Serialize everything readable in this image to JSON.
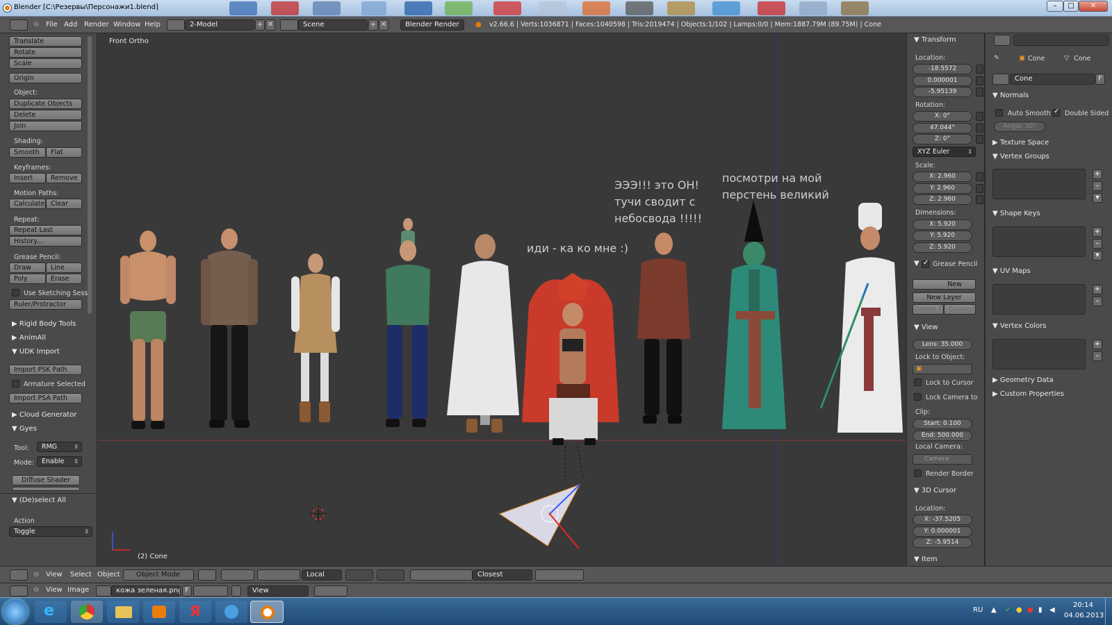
{
  "window": {
    "title": "Blender [C:\\Резервы\\Персонажи1.blend]",
    "minimize": "–",
    "maximize": "□",
    "close": "✕"
  },
  "info_header": {
    "menus": [
      "File",
      "Add",
      "Render",
      "Window",
      "Help"
    ],
    "screen_layout": "2-Model",
    "scene": "Scene",
    "render_engine": "Blender Render",
    "stats": "v2.66.6 | Verts:1036871 | Faces:1040598 | Tris:2019474 | Objects:1/102 | Lamps:0/0 | Mem:1887.79M (89.75M) | Cone"
  },
  "tool_shelf": {
    "transform": [
      "Translate",
      "Rotate",
      "Scale"
    ],
    "origin": "Origin",
    "object_label": "Object:",
    "object_buttons": [
      "Duplicate Objects",
      "Delete",
      "Join"
    ],
    "shading_label": "Shading:",
    "shading": [
      "Smooth",
      "Flat"
    ],
    "keyframes_label": "Keyframes:",
    "keyframes": [
      "Insert",
      "Remove"
    ],
    "motion_label": "Motion Paths:",
    "motion": [
      "Calculate",
      "Clear"
    ],
    "repeat_label": "Repeat:",
    "repeat": [
      "Repeat Last",
      "History..."
    ],
    "grease_label": "Grease Pencil:",
    "grease_row1": [
      "Draw",
      "Line"
    ],
    "grease_row2": [
      "Poly",
      "Erase"
    ],
    "use_sketching": "Use Sketching Sessi",
    "ruler": "Ruler/Protractor",
    "rigid_body": "Rigid Body Tools",
    "animall": "AnimAll",
    "udk_import": "UDK Import",
    "import_psk": "Import PSK Path",
    "armature_selected": "Armature Selected",
    "import_psa": "Import PSA Path",
    "cloud_generator": "Cloud Generator",
    "gyes": "Gyes",
    "tool_label": "Tool:",
    "tool_value": "RMG",
    "mode_label": "Mode:",
    "mode_value": "Enable",
    "diffuse_shader": "Diffuse Shader",
    "deselect_all": "(De)select All",
    "action_label": "Action",
    "action_value": "Toggle"
  },
  "viewport": {
    "view_name": "Front Ortho",
    "active_object": "(2) Cone",
    "speech": {
      "come_here": "иди - ка  ко мне :)",
      "he_line1": "ЭЭЭ!!! это ОН!",
      "he_line2": "тучи сводит с",
      "he_line3": "небосвода !!!!!",
      "ring_line1": "посмотри на мой",
      "ring_line2": "перстень великий"
    }
  },
  "n_panel": {
    "transform": "Transform",
    "location_label": "Location:",
    "location": [
      "-18.5572",
      "0.000001",
      "-5.95139"
    ],
    "rotation_label": "Rotation:",
    "rotation": [
      "X: 0°",
      "47.044°",
      "Z: 0°"
    ],
    "rotation_mode": "XYZ Euler",
    "scale_label": "Scale:",
    "scale": [
      "X: 2.960",
      "Y: 2.960",
      "Z: 2.960"
    ],
    "dimensions_label": "Dimensions:",
    "dimensions": [
      "X: 5.920",
      "Y: 5.920",
      "Z: 5.920"
    ],
    "grease_pencil": "Grease Pencil",
    "new": "New",
    "new_layer": "New Layer",
    "delete_frame": "Delete Fra",
    "convert": "Convert",
    "view": "View",
    "lens": "Lens: 35.000",
    "lock_to_object": "Lock to Object:",
    "lock_to_cursor": "Lock to Cursor",
    "lock_camera": "Lock Camera to",
    "clip_label": "Clip:",
    "clip_start": "Start: 0.100",
    "clip_end": "End: 500.000",
    "local_camera_label": "Local Camera:",
    "camera": "Camera",
    "render_border": "Render Border",
    "cursor_3d": "3D Cursor",
    "cursor_location_label": "Location:",
    "cursor_location": [
      "X: -37.5205",
      "Y: 0.000001",
      "Z: -5.9514"
    ],
    "item": "Item"
  },
  "properties": {
    "breadcrumb_obj": "Cone",
    "breadcrumb_mesh": "Cone",
    "mesh_name": "Cone",
    "fake_user": "F",
    "normals": "Normals",
    "auto_smooth": "Auto Smooth",
    "double_sided": "Double Sided",
    "angle": "Angle: 30°",
    "texture_space": "Texture Space",
    "vertex_groups": "Vertex Groups",
    "shape_keys": "Shape Keys",
    "uv_maps": "UV Maps",
    "vertex_colors": "Vertex Colors",
    "geometry_data": "Geometry Data",
    "custom_properties": "Custom Properties"
  },
  "view3d_header": {
    "menus": [
      "View",
      "Select",
      "Object"
    ],
    "mode": "Object Mode",
    "orientation": "Local",
    "snap": "Closest"
  },
  "image_header": {
    "menus": [
      "View",
      "Image"
    ],
    "image_name": "кожа зеленая.png",
    "fake": "F",
    "view_mode": "View"
  },
  "taskbar": {
    "language": "RU",
    "time": "20:14",
    "date": "04.06.2013"
  }
}
